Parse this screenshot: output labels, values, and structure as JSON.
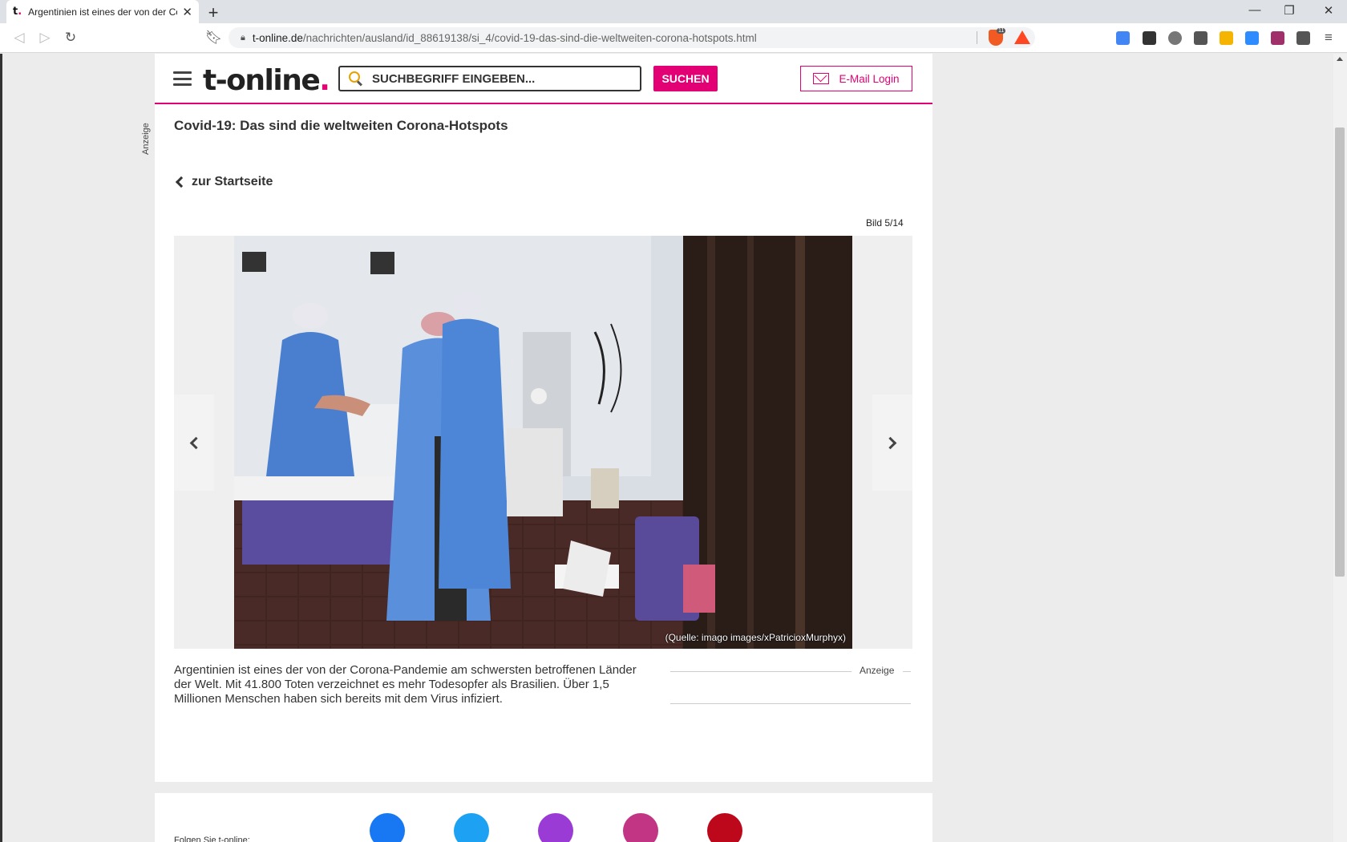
{
  "browser": {
    "tab_title": "Argentinien ist eines der von der Corona-Pandemie",
    "tab_favicon": "t.",
    "url_host": "t-online.de",
    "url_path": "/nachrichten/ausland/id_88619138/si_4/covid-19-das-sind-die-weltweiten-corona-hotspots.html",
    "brave_badge": "11"
  },
  "header": {
    "logo": "t-online",
    "logo_dot": ".",
    "search_placeholder": "SUCHBEGRIFF EINGEBEN...",
    "search_button": "SUCHEN",
    "mail_button": "E-Mail Login",
    "side_ad_label": "Anzeige"
  },
  "article": {
    "title": "Covid-19: Das sind die weltweiten Corona-Hotspots",
    "back_link": "zur Startseite",
    "counter": "Bild 5/14",
    "photo_source": "(Quelle: imago images/xPatricioxMurphyx)",
    "caption": "Argentinien ist eines der von der Corona-Pandemie am schwersten betroffenen Länder der Welt. Mit 41.800 Toten verzeichnet es mehr Todesopfer als Brasilien. Über 1,5 Millionen Menschen haben sich bereits mit dem Virus infiziert.",
    "ad_label": "Anzeige"
  },
  "footer": {
    "follow_text": "Folgen Sie t-online:",
    "social": [
      {
        "name": "facebook-icon",
        "color": "#1877f2"
      },
      {
        "name": "twitter-icon",
        "color": "#1da1f2"
      },
      {
        "name": "podcast-icon",
        "color": "#9b3bd6"
      },
      {
        "name": "instagram-icon",
        "color": "#c13584"
      },
      {
        "name": "pinterest-icon",
        "color": "#bd081c"
      }
    ]
  },
  "colors": {
    "brand": "#e20074"
  }
}
